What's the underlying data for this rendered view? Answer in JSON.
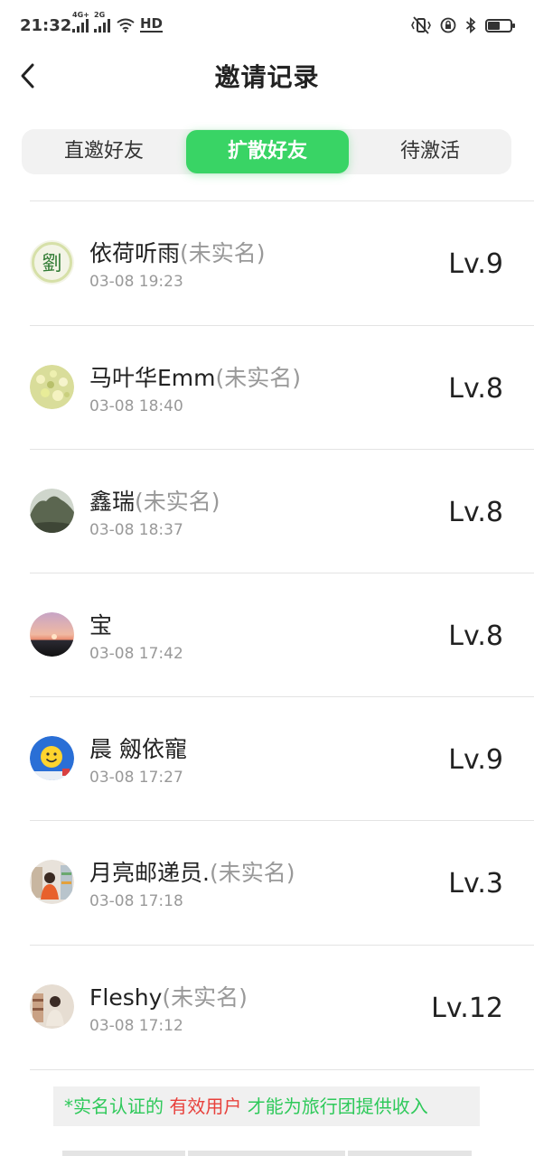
{
  "status_bar": {
    "time": "21:32",
    "network_1": "4G+",
    "network_2": "2G",
    "hd_badge": "HD",
    "battery_level": 0.55
  },
  "header": {
    "title": "邀请记录"
  },
  "tabs": [
    {
      "label": "直邀好友",
      "active": false
    },
    {
      "label": "扩散好友",
      "active": true
    },
    {
      "label": "待激活",
      "active": false
    }
  ],
  "list": [
    {
      "name": "依荷听雨",
      "tag": "(未实名)",
      "date": "03-08 19:23",
      "level": "Lv.9",
      "avatar_text": "劉"
    },
    {
      "name": "马叶华Emm",
      "tag": "(未实名)",
      "date": "03-08 18:40",
      "level": "Lv.8"
    },
    {
      "name": "鑫瑞",
      "tag": "(未实名)",
      "date": "03-08 18:37",
      "level": "Lv.8"
    },
    {
      "name": "宝",
      "tag": "",
      "date": "03-08 17:42",
      "level": "Lv.8"
    },
    {
      "name": "晨  劔依寵",
      "tag": "",
      "date": "03-08 17:27",
      "level": "Lv.9"
    },
    {
      "name": "月亮邮递员.",
      "tag": "(未实名)",
      "date": "03-08 17:18",
      "level": "Lv.3"
    },
    {
      "name": "Fleshy",
      "tag": "(未实名)",
      "date": "03-08 17:12",
      "level": "Lv.12"
    }
  ],
  "notice": {
    "part1": "*实名认证的",
    "part2": "有效用户",
    "part3": "才能为旅行团提供收入"
  },
  "colors": {
    "accent": "#39d465",
    "notice_green": "#2ec95a",
    "notice_red": "#e8413c",
    "muted": "#999999"
  }
}
